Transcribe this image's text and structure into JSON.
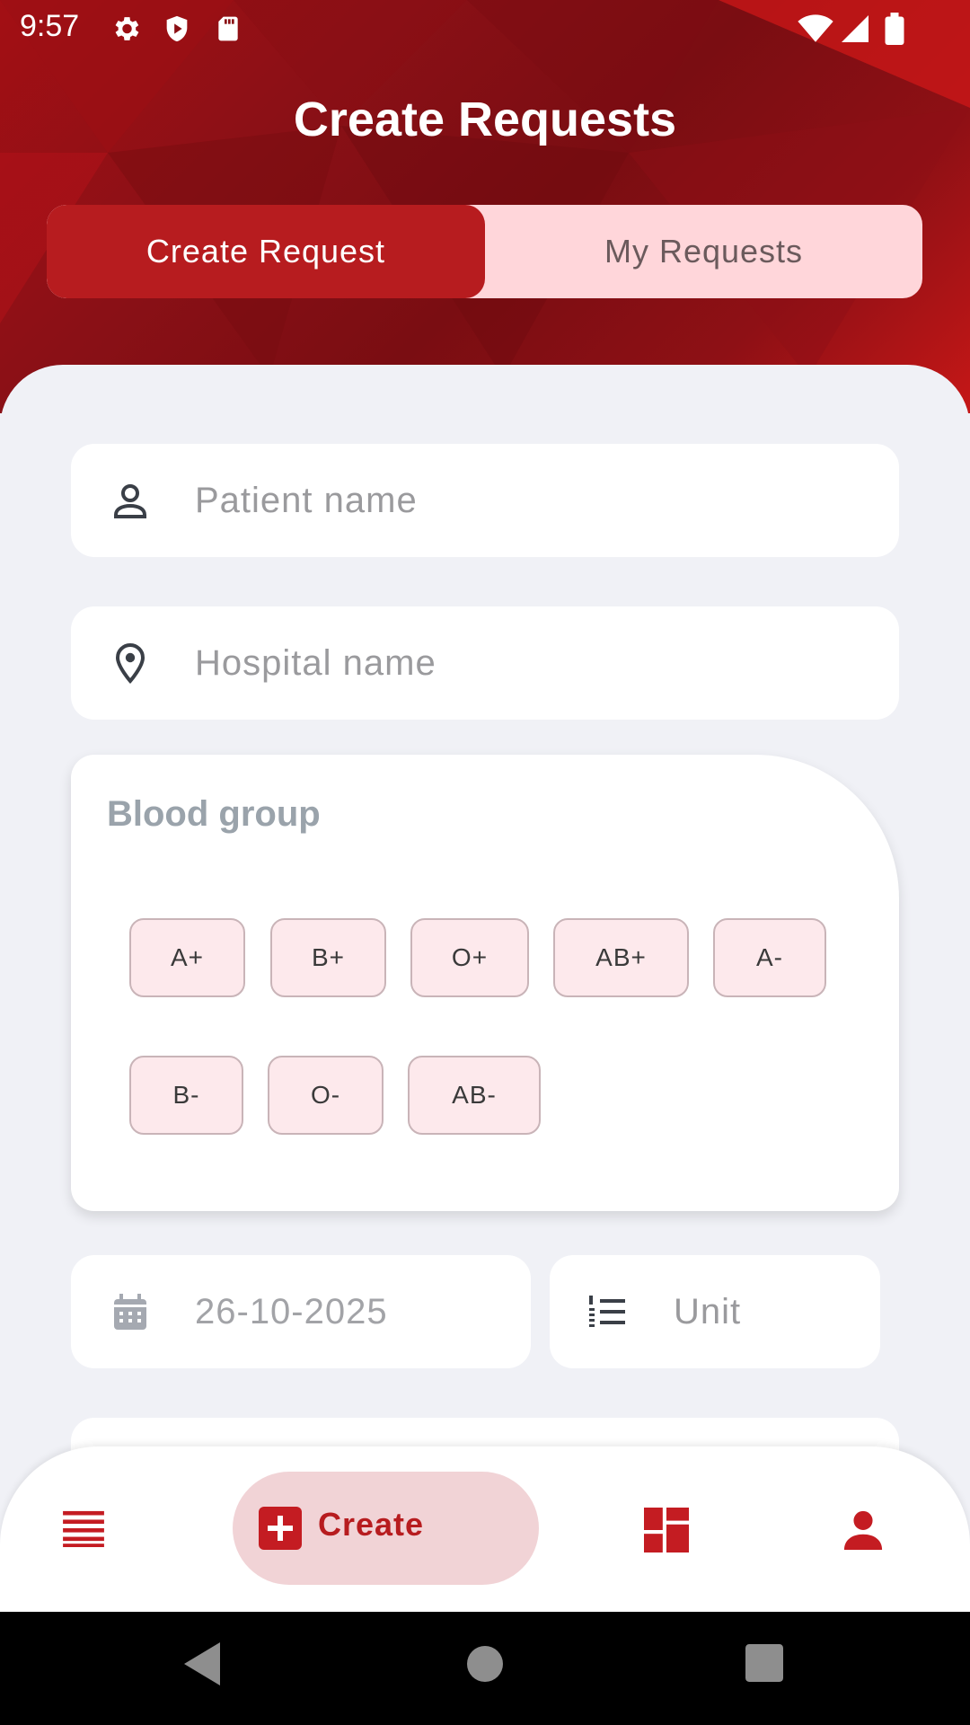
{
  "status_bar": {
    "time": "9:57"
  },
  "header": {
    "title": "Create Requests"
  },
  "tabs": [
    {
      "label": "Create Request",
      "active": true
    },
    {
      "label": "My Requests",
      "active": false
    }
  ],
  "form": {
    "patient_name": {
      "placeholder": "Patient name",
      "icon": "person-icon"
    },
    "hospital_name": {
      "placeholder": "Hospital name",
      "icon": "location-pin-icon"
    },
    "blood_group": {
      "title": "Blood group",
      "options": [
        "A+",
        "B+",
        "O+",
        "AB+",
        "A-",
        "B-",
        "O-",
        "AB-"
      ]
    },
    "date": {
      "value": "26-10-2025",
      "icon": "calendar-icon"
    },
    "unit": {
      "placeholder": "Unit",
      "icon": "numbered-list-icon"
    }
  },
  "bottom_nav": {
    "items": [
      {
        "name": "list-icon"
      },
      {
        "name": "create",
        "label": "Create",
        "active": true
      },
      {
        "name": "dashboard-icon"
      },
      {
        "name": "profile-icon"
      }
    ]
  },
  "colors": {
    "primary": "#b71c1f",
    "chip_bg": "#fde9ec",
    "tab_inactive_bg": "#ffd6da"
  }
}
